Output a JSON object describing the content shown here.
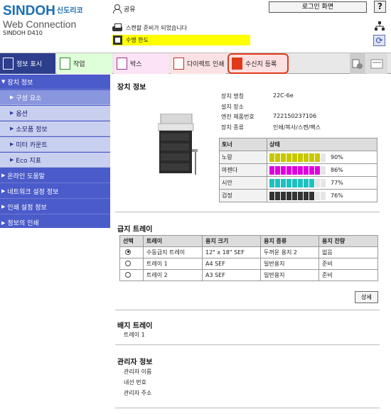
{
  "header": {
    "brand": "SINDOH",
    "brand_kr": "신도리코",
    "product": "Web Connection",
    "model": "SINDOH D410",
    "user_label": "공유",
    "login_button": "로그인 화면",
    "help_button": "?",
    "status_text": "스캔할 준비가 되었습니다",
    "warning_text": "수명 한도"
  },
  "tabs": {
    "info": "정보 표시",
    "job": "작업",
    "box": "박스",
    "direct_print": "다이렉트 인쇄",
    "address": "수신지 등록"
  },
  "sidebar": {
    "device_info": "장치 정보",
    "sub_items": [
      "구성 요소",
      "옵션",
      "소모품 정보",
      "미터 카운트",
      "Eco 지표"
    ],
    "top_items": [
      "온라인 도움말",
      "네트워크 설정 정보",
      "인쇄 설정 정보",
      "정보의 인쇄"
    ]
  },
  "device": {
    "section_title": "장치 정보",
    "fields": [
      {
        "label": "장치 명칭",
        "value": "22C-6e"
      },
      {
        "label": "설치 장소",
        "value": ""
      },
      {
        "label": "엔진 제품번호",
        "value": "722150237106"
      },
      {
        "label": "장치 종류",
        "value": "인쇄/복사/스캔/팩스"
      }
    ]
  },
  "toner": {
    "header_name": "토너",
    "header_status": "상태",
    "rows": [
      {
        "name": "노랑",
        "percent": 90,
        "label": "90%",
        "color": "#c8c800"
      },
      {
        "name": "마젠다",
        "percent": 86,
        "label": "86%",
        "color": "#e000e0"
      },
      {
        "name": "시안",
        "percent": 77,
        "label": "77%",
        "color": "#20c0c0"
      },
      {
        "name": "검정",
        "percent": 76,
        "label": "76%",
        "color": "#333333"
      }
    ]
  },
  "tray": {
    "section_title": "급지 트레이",
    "headers": [
      "선택",
      "트레이",
      "용지 크기",
      "용지 종류",
      "용지 잔량"
    ],
    "rows": [
      {
        "selected": true,
        "tray": "수동급지 트레이",
        "size": "12\" x 18\" SEF",
        "type": "두꺼운 용지 2",
        "remaining": "없음"
      },
      {
        "selected": false,
        "tray": "트레이 1",
        "size": "A4 SEF",
        "type": "일반용지",
        "remaining": "준비"
      },
      {
        "selected": false,
        "tray": "트레이 2",
        "size": "A3 SEF",
        "type": "일반용지",
        "remaining": "준비"
      }
    ],
    "detail_button": "상세"
  },
  "output_tray": {
    "section_title": "배지 트레이",
    "item": "트레이 1"
  },
  "admin": {
    "section_title": "관리자 정보",
    "fields": [
      "관리자 이름",
      "내선 번호",
      "관리자 주소"
    ]
  }
}
